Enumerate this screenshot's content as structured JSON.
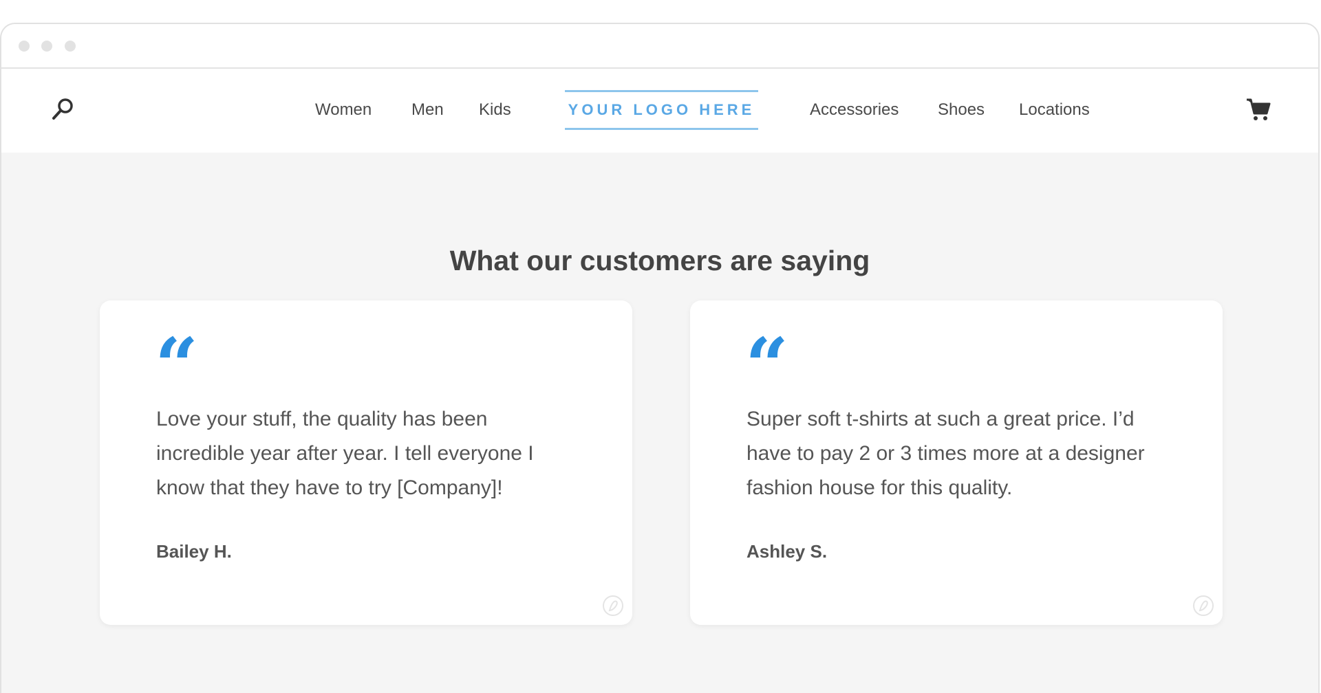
{
  "nav": {
    "left_items": [
      "Women",
      "Men",
      "Kids"
    ],
    "logo_text": "YOUR LOGO HERE",
    "right_items": [
      "Accessories",
      "Shoes",
      "Locations"
    ],
    "search_icon": "search-icon",
    "cart_icon": "cart-icon"
  },
  "section": {
    "heading": "What our customers are saying"
  },
  "testimonials": [
    {
      "quote_mark": "“",
      "text": "Love your stuff, the quality has been incredible year after year. I tell everyone I know that they have to try [Company]!",
      "author": "Bailey H."
    },
    {
      "quote_mark": "“",
      "text": "Super soft t-shirts at such a great price. I’d have to pay 2 or 3 times more at a designer fashion house for this quality.",
      "author": "Ashley S."
    }
  ],
  "colors": {
    "accent": "#2b8fe0",
    "logo": "#5aa8e5",
    "background": "#f5f5f5",
    "text": "#555555"
  }
}
